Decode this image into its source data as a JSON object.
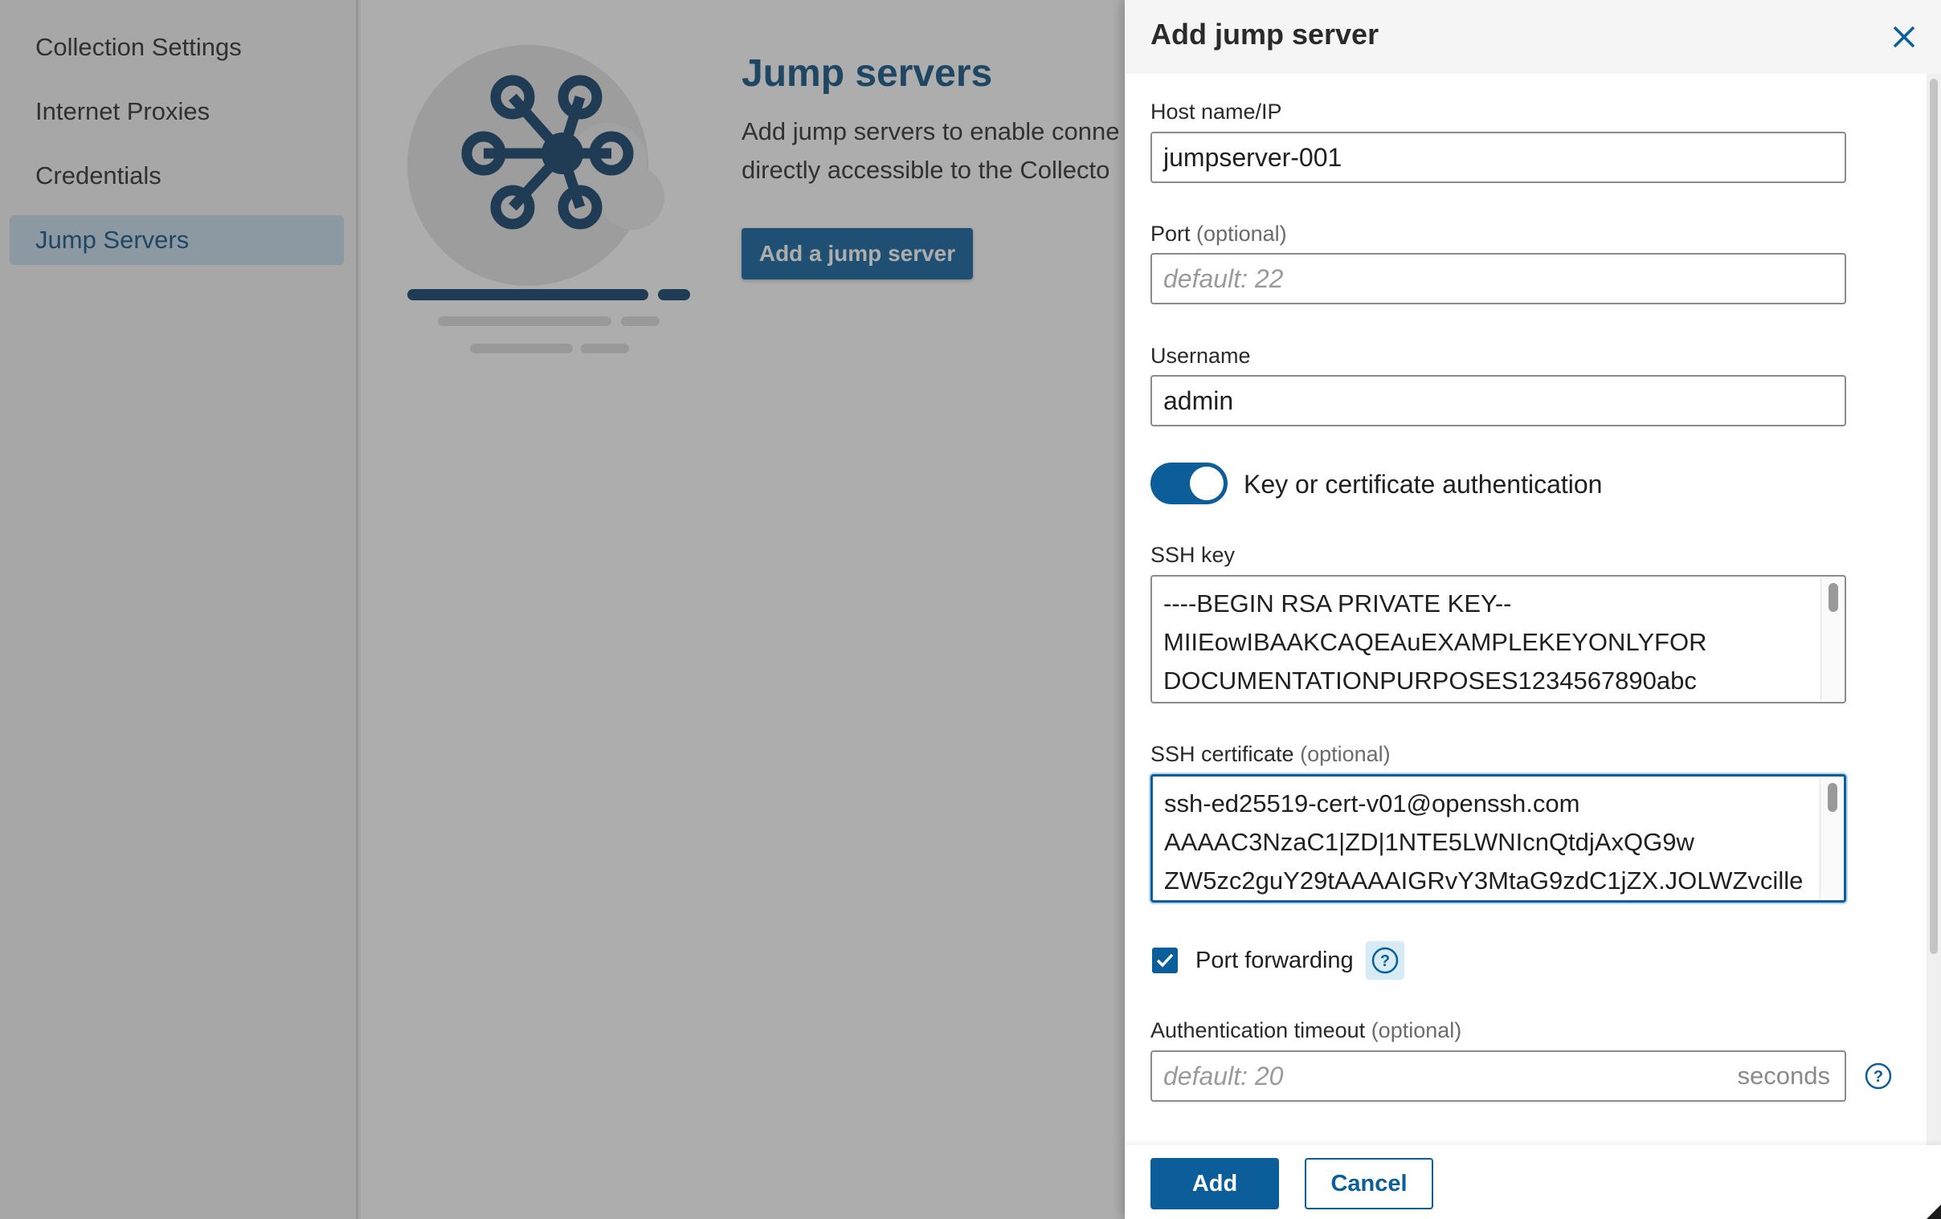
{
  "sidebar": {
    "items": [
      {
        "label": "Collection Settings"
      },
      {
        "label": "Internet Proxies"
      },
      {
        "label": "Credentials"
      },
      {
        "label": "Jump Servers",
        "active": true
      }
    ]
  },
  "main": {
    "title": "Jump servers",
    "description_line1": "Add jump servers to enable conne",
    "description_line2": "directly accessible to the Collecto",
    "add_button": "Add a jump server"
  },
  "drawer": {
    "title": "Add jump server",
    "close_icon": "close-icon",
    "host": {
      "label": "Host name/IP",
      "value": "jumpserver-001"
    },
    "port": {
      "label": "Port",
      "optional": "(optional)",
      "placeholder": "default: 22"
    },
    "username": {
      "label": "Username",
      "value": "admin"
    },
    "key_auth": {
      "label": "Key or certificate authentication",
      "enabled": true
    },
    "ssh_key": {
      "label": "SSH key",
      "lines": [
        "----BEGIN RSA PRIVATE KEY--",
        "MIIEowIBAAKCAQEAuEXAMPLEKEYONLYFOR",
        "DOCUMENTATIONPURPOSES1234567890abc"
      ]
    },
    "ssh_cert": {
      "label": "SSH certificate",
      "optional": "(optional)",
      "lines": [
        "ssh-ed25519-cert-v01@openssh.com",
        "AAAAC3NzaC1|ZD|1NTE5LWNIcnQtdjAxQG9w",
        "ZW5zc2guY29tAAAAIGRvY3MtaG9zdC1jZX.JOLWZvcille"
      ]
    },
    "port_forwarding": {
      "label": "Port forwarding",
      "checked": true,
      "help_icon": "help-icon"
    },
    "auth_timeout": {
      "label": "Authentication timeout",
      "optional": "(optional)",
      "placeholder": "default: 20",
      "suffix": "seconds",
      "help_icon": "help-icon"
    },
    "add_button": "Add",
    "cancel_button": "Cancel"
  },
  "colors": {
    "accent": "#0b5e9a",
    "title": "#0b4f80",
    "nav_active_bg": "#c8dcec"
  }
}
